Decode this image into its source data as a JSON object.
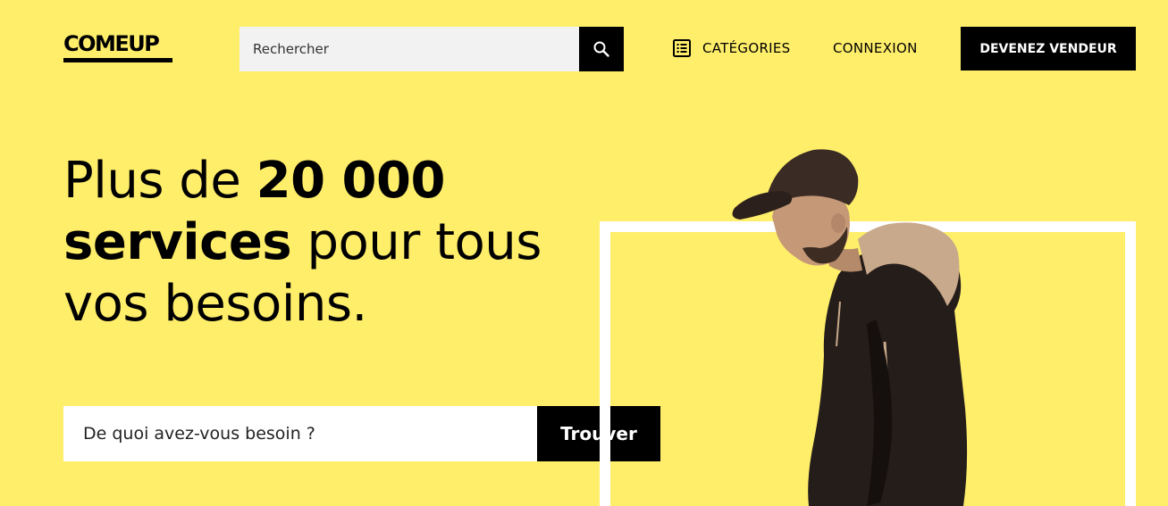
{
  "header": {
    "logo_text": "COMEUP",
    "search": {
      "placeholder": "Rechercher"
    },
    "nav": {
      "categories_label": "CATÉGORIES",
      "login_label": "CONNEXION",
      "seller_button_label": "DEVENEZ VENDEUR"
    }
  },
  "hero": {
    "title_part1": "Plus de ",
    "title_bold1": "20 000",
    "title_bold2": "services",
    "title_part2": " pour tous vos besoins.",
    "search": {
      "placeholder": "De quoi avez-vous besoin ?"
    },
    "find_button_label": "Trouver"
  },
  "colors": {
    "background": "#ffee6a",
    "accent": "#000000",
    "frame": "#ffffff"
  },
  "icons": [
    "search-icon",
    "categories-list-icon"
  ]
}
